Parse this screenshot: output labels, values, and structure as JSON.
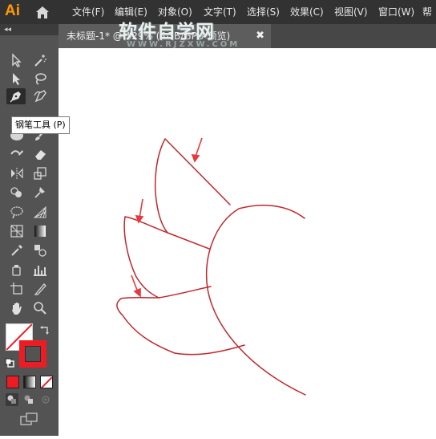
{
  "app": {
    "logo": "Ai",
    "home_icon": "home-icon"
  },
  "menu": {
    "items": [
      "文件(F)",
      "编辑(E)",
      "对象(O)",
      "文字(T)",
      "选择(S)",
      "效果(C)",
      "视图(V)",
      "窗口(W)",
      "帮"
    ]
  },
  "toolbar": {
    "collapse_label": "◂◂",
    "tools": [
      "selection-icon",
      "direct-selection-icon",
      "magic-wand-icon",
      "lasso-icon",
      "pen-icon",
      "curvature-icon",
      "ellipse-icon",
      "paintbrush-icon",
      "shaper-icon",
      "eraser-icon",
      "reflect-icon",
      "scale-icon",
      "shape-builder-icon",
      "pin-icon",
      "warp-icon",
      "mesh-icon",
      "grid-icon",
      "gradient-icon",
      "eyedropper-icon",
      "blend-icon",
      "symbol-sprayer-icon",
      "column-graph-icon",
      "artboard-icon",
      "slice-icon",
      "hand-icon",
      "zoom-icon"
    ],
    "colors": {
      "fill": "#ffffff",
      "stroke": "#ed1c24"
    }
  },
  "document_tab": {
    "title": "未标题-1* @ 129% (RGB/GPU 预览)",
    "close": "✖"
  },
  "watermark": {
    "title": "软件自学网",
    "subtitle": "WWW.RJZXW.COM"
  },
  "tooltip": {
    "text": "钢笔工具 (P)"
  },
  "artwork": {
    "stroke_color": "#c1272d",
    "arrow_color": "#e8383d"
  }
}
